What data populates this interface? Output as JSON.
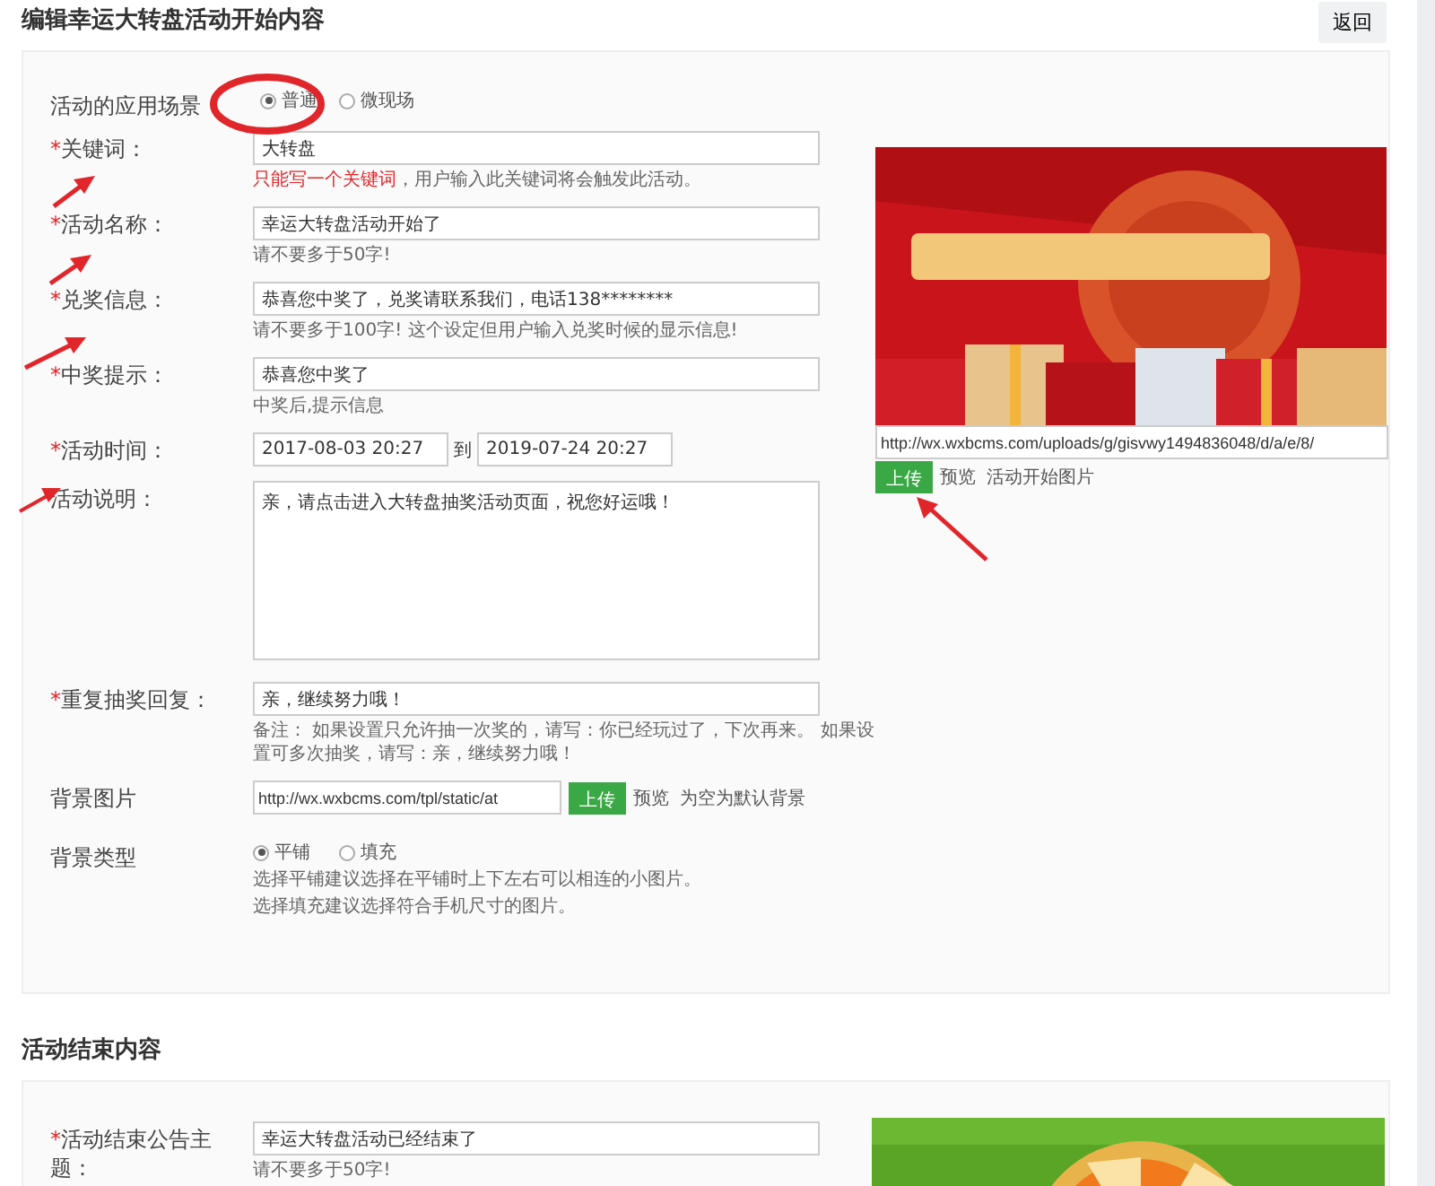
{
  "title": "编辑幸运大转盘活动开始内容",
  "back_button": "返回",
  "start_section": {
    "scene": {
      "label": "活动的应用场景",
      "options": [
        {
          "label": "普通",
          "selected": true
        },
        {
          "label": "微现场",
          "selected": false
        }
      ]
    },
    "fields": [
      {
        "kind": "input",
        "required_mark": "*",
        "label": "关键词：",
        "value": "大转盘",
        "hint_warning": "只能写一个关键词",
        "hint": "，用户输入此关键词将会触发此活动。"
      },
      {
        "kind": "input",
        "required_mark": "*",
        "label": "活动名称：",
        "value": "幸运大转盘活动开始了",
        "hint": "请不要多于50字!"
      },
      {
        "kind": "input",
        "required_mark": "*",
        "label": "兑奖信息：",
        "value": "恭喜您中奖了，兑奖请联系我们，电话138********",
        "hint": "请不要多于100字! 这个设定但用户输入兑奖时候的显示信息!"
      },
      {
        "kind": "input",
        "required_mark": "*",
        "label": "中奖提示：",
        "value": "恭喜您中奖了",
        "hint": "中奖后,提示信息"
      },
      {
        "kind": "daterange",
        "required_mark": "*",
        "label": "活动时间：",
        "start": "2017-08-03 20:27",
        "separator": "到",
        "end": "2019-07-24 20:27"
      },
      {
        "kind": "textarea",
        "label": "活动说明：",
        "value": "亲，请点击进入大转盘抽奖活动页面，祝您好运哦！"
      },
      {
        "kind": "input",
        "required_mark": "*",
        "label": "重复抽奖回复：",
        "value": "亲，继续努力哦！",
        "hint": "备注： 如果设置只允许抽一次奖的，请写：你已经玩过了，下次再来。 如果设置可多次抽奖，请写：亲，继续努力哦！"
      },
      {
        "kind": "upload",
        "label": "背景图片",
        "value": "http://wx.wxbcms.com/tpl/static/at",
        "button": "上传",
        "preview": "预览",
        "hint": "为空为默认背景"
      },
      {
        "kind": "radio",
        "label": "背景类型",
        "options": [
          {
            "label": "平铺",
            "selected": true
          },
          {
            "label": "填充",
            "selected": false
          }
        ],
        "hints": [
          "选择平铺建议选择在平铺时上下左右可以相连的小图片。",
          "选择填充建议选择符合手机尺寸的图片。"
        ]
      }
    ],
    "image": {
      "kind": "picture",
      "url": "http://wx.wxbcms.com/uploads/g/gisvwy1494836048/d/a/e/8/",
      "button": "上传",
      "preview": "预览",
      "caption": "活动开始图片"
    }
  },
  "end_section": {
    "title": "活动结束内容",
    "fields": [
      {
        "kind": "input",
        "required_mark": "*",
        "label": "活动结束公告主题：",
        "value": "幸运大转盘活动已经结束了",
        "hint": "请不要多于50字!"
      }
    ]
  }
}
